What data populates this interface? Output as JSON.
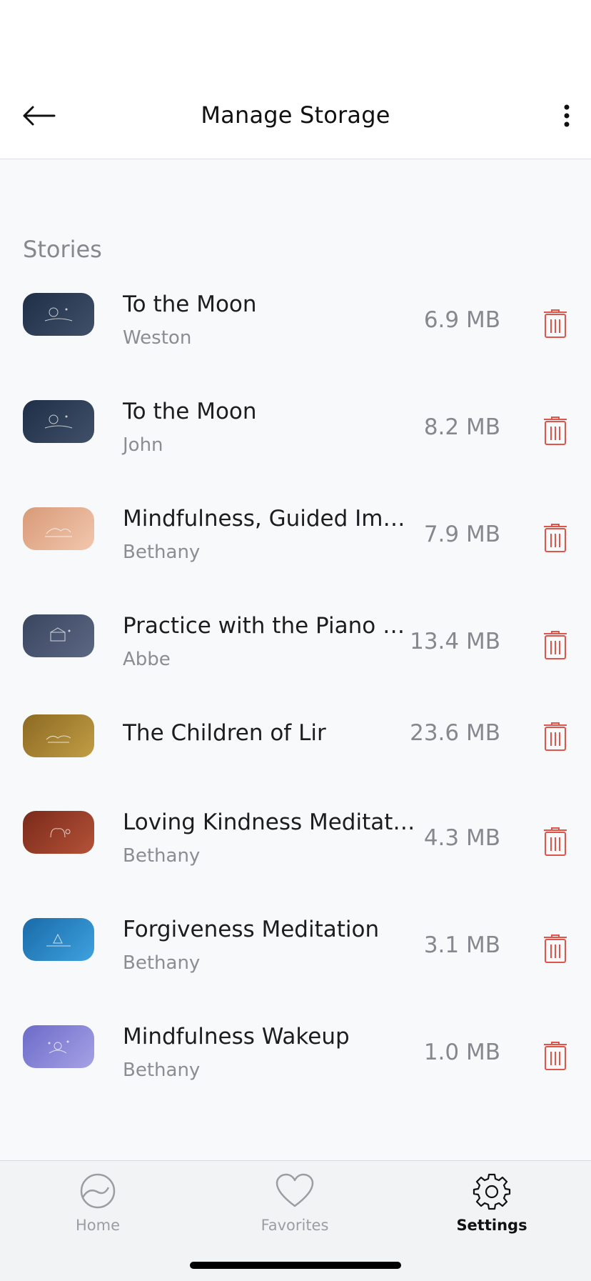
{
  "header": {
    "title": "Manage Storage",
    "back_icon": "back-arrow-icon",
    "menu_icon": "more-vertical-icon"
  },
  "section": {
    "title": "Stories"
  },
  "items": [
    {
      "title": "To the Moon",
      "subtitle": "Weston",
      "size": "6.9 MB",
      "color_from": "#1f2f47",
      "color_to": "#3f5068"
    },
    {
      "title": "To the Moon",
      "subtitle": "John",
      "size": "8.2 MB",
      "color_from": "#1f2f47",
      "color_to": "#3f5068"
    },
    {
      "title": "Mindfulness, Guided Imag…",
      "subtitle": "Bethany",
      "size": "7.9 MB",
      "color_from": "#d89a78",
      "color_to": "#f2c7ad"
    },
    {
      "title": "Practice with the Piano Pl…",
      "subtitle": "Abbe",
      "size": "13.4 MB",
      "color_from": "#3a4660",
      "color_to": "#5c6883"
    },
    {
      "title": "The Children of Lir",
      "subtitle": "",
      "size": "23.6 MB",
      "color_from": "#8c6a22",
      "color_to": "#c19d45"
    },
    {
      "title": "Loving Kindness Meditation",
      "subtitle": "Bethany",
      "size": "4.3 MB",
      "color_from": "#7a2a1a",
      "color_to": "#b45238"
    },
    {
      "title": "Forgiveness Meditation",
      "subtitle": "Bethany",
      "size": "3.1 MB",
      "color_from": "#1a6aa8",
      "color_to": "#3ea2df"
    },
    {
      "title": "Mindfulness Wakeup",
      "subtitle": "Bethany",
      "size": "1.0 MB",
      "color_from": "#6c6bc8",
      "color_to": "#a6a2e6"
    }
  ],
  "tabs": [
    {
      "label": "Home",
      "icon": "home-wave-icon",
      "active": false
    },
    {
      "label": "Favorites",
      "icon": "heart-icon",
      "active": false
    },
    {
      "label": "Settings",
      "icon": "gear-icon",
      "active": true
    }
  ],
  "colors": {
    "accent_delete": "#e0554a",
    "tab_inactive": "#9a9ea3",
    "tab_active": "#111111"
  }
}
